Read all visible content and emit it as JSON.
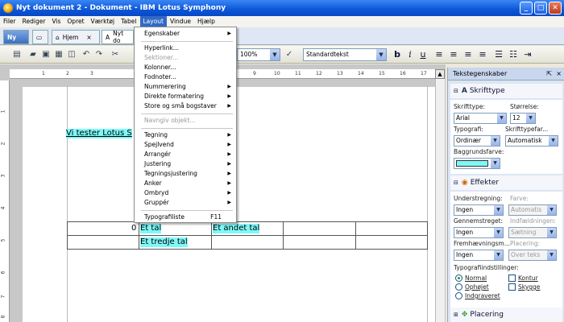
{
  "window": {
    "title": "Nyt dokument 2 - Dokument - IBM Lotus Symphony",
    "min": "_",
    "max": "□",
    "close": "✕"
  },
  "menubar": [
    "Filer",
    "Rediger",
    "Vis",
    "Opret",
    "Værktøj",
    "Tabel",
    "Layout",
    "Vindue",
    "Hjælp"
  ],
  "tabs": {
    "home_button": "Ny",
    "home": "Hjem",
    "close": "×",
    "doc": "Nyt do"
  },
  "toolbar": {
    "zoom": "100%",
    "style": "Standardtekst",
    "bold": "b",
    "italic": "i",
    "underline": "u"
  },
  "ruler_h": [
    "1",
    "2",
    "3",
    "9",
    "10",
    "11",
    "12",
    "13",
    "14",
    "15",
    "16",
    "17"
  ],
  "ruler_v": [
    "1",
    "2",
    "3",
    "4",
    "5",
    "6",
    "7",
    "8"
  ],
  "document": {
    "line1": "Vi tester Lotus S",
    "cell_zero": "0",
    "cell1": "Et tal",
    "cell2": "Et andet tal",
    "cell3": "Et tredje tal"
  },
  "layout_menu": {
    "items": [
      {
        "label": "Egenskaber",
        "sub": true
      },
      {
        "sep": true
      },
      {
        "label": "Hyperlink..."
      },
      {
        "label": "Sektioner...",
        "disabled": true
      },
      {
        "label": "Kolonner..."
      },
      {
        "label": "Fodnoter..."
      },
      {
        "label": "Nummerering",
        "sub": true
      },
      {
        "label": "Direkte formatering",
        "sub": true
      },
      {
        "label": "Store og små bogstaver",
        "sub": true
      },
      {
        "sep": true
      },
      {
        "label": "Navngiv objekt...",
        "disabled": true
      },
      {
        "sep": true
      },
      {
        "label": "Tegning",
        "sub": true
      },
      {
        "label": "Spejlvend",
        "sub": true
      },
      {
        "label": "Arrangér",
        "sub": true
      },
      {
        "label": "Justering",
        "sub": true
      },
      {
        "label": "Tegningsjustering",
        "sub": true
      },
      {
        "label": "Anker",
        "sub": true
      },
      {
        "label": "Ombryd",
        "sub": true
      },
      {
        "label": "Gruppér",
        "sub": true
      },
      {
        "sep": true
      },
      {
        "label": "Typografiliste",
        "key": "F11"
      }
    ]
  },
  "panel": {
    "title": "Tekstegenskaber",
    "font_section": "Skrifttype",
    "font_label": "Skrifttype:",
    "font_value": "Arial",
    "size_label": "Størrelse:",
    "size_value": "12",
    "typo_label": "Typografi:",
    "typo_value": "Ordinær",
    "fontcolor_label": "Skrifttypefar...",
    "fontcolor_value": "Automatisk",
    "bg_label": "Baggrundsfarve:",
    "bg_color": "#7ff7f7",
    "effects_section": "Effekter",
    "underline_label": "Understregning:",
    "underline_value": "Ingen",
    "color_label": "Farve:",
    "color_value": "Automatis",
    "strike_label": "Gennemstreget:",
    "strike_value": "Ingen",
    "indent_label": "Indfældningen:",
    "indent_value": "Sætning",
    "emph_label": "Fremhævningsm...",
    "emph_value": "Ingen",
    "place_label": "Placering:",
    "place_value": "Over teks",
    "typoset_label": "Typografiindstillinger:",
    "normal": "Normal",
    "outline": "Kontur",
    "raised": "Ophøjet",
    "shadow": "Skygge",
    "engraved": "Indgraveret",
    "placement_section": "Placering"
  }
}
